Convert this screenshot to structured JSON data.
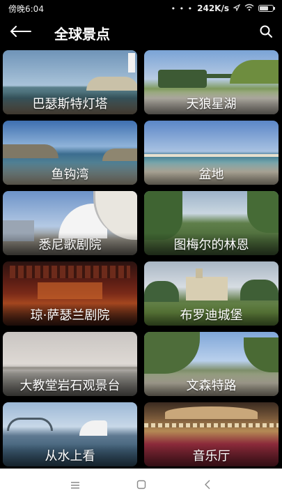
{
  "status_bar": {
    "time": "傍晚6:04",
    "network_speed": "242K/s",
    "indicators": "• • •",
    "icons": [
      "location-icon",
      "wifi-icon",
      "battery-icon"
    ]
  },
  "header": {
    "title": "全球景点",
    "back_icon": "back-arrow-icon",
    "search_icon": "search-icon"
  },
  "attractions": [
    {
      "name": "巴瑟斯特灯塔"
    },
    {
      "name": "天狼星湖"
    },
    {
      "name": "鱼钩湾"
    },
    {
      "name": "盆地"
    },
    {
      "name": "悉尼歌剧院"
    },
    {
      "name": "图梅尔的林恩"
    },
    {
      "name": "琼·萨瑟兰剧院"
    },
    {
      "name": "布罗迪城堡"
    },
    {
      "name": "大教堂岩石观景台"
    },
    {
      "name": "文森特路"
    },
    {
      "name": "从水上看"
    },
    {
      "name": "音乐厅"
    }
  ],
  "nav_bar": {
    "icons": [
      "menu-icon",
      "home-square-icon",
      "back-triangle-icon"
    ]
  }
}
